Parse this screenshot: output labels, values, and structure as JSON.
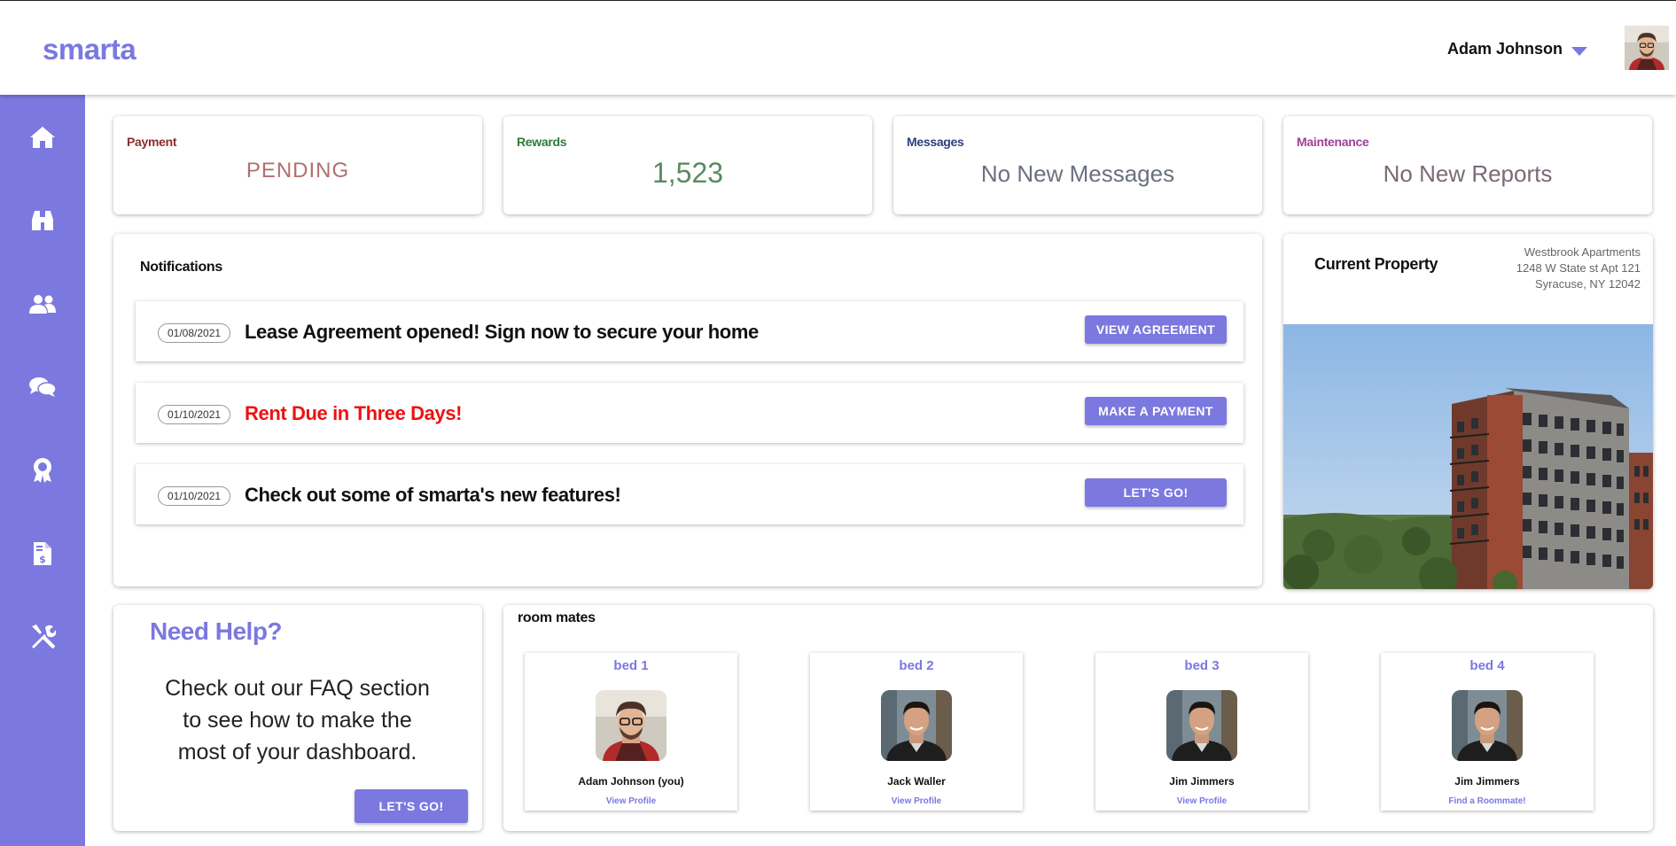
{
  "header": {
    "logo": "smarta",
    "user_name": "Adam Johnson"
  },
  "sidebar": {
    "items": [
      {
        "icon": "home-icon"
      },
      {
        "icon": "binoculars-icon"
      },
      {
        "icon": "users-icon"
      },
      {
        "icon": "chat-icon"
      },
      {
        "icon": "award-icon"
      },
      {
        "icon": "invoice-icon"
      },
      {
        "icon": "tools-icon"
      }
    ]
  },
  "stats": {
    "payment": {
      "label": "Payment",
      "value": "PENDING",
      "label_color": "#8b2e2e",
      "value_color": "#b07070"
    },
    "rewards": {
      "label": "Rewards",
      "value": "1,523",
      "label_color": "#2e7a3e",
      "value_color": "#5b8a60"
    },
    "messages": {
      "label": "Messages",
      "value": "No New Messages",
      "label_color": "#2e3f7a",
      "value_color": "#6a7080"
    },
    "maintenance": {
      "label": "Maintenance",
      "value": "No New Reports",
      "label_color": "#a0409a",
      "value_color": "#7a6a78"
    }
  },
  "notifications": {
    "title": "Notifications",
    "items": [
      {
        "date": "01/08/2021",
        "text": "Lease Agreement opened! Sign now to secure your home",
        "button": "VIEW AGREEMENT",
        "color": "#111111"
      },
      {
        "date": "01/10/2021",
        "text": "Rent Due in Three Days!",
        "button": "MAKE A PAYMENT",
        "color": "#ee1111"
      },
      {
        "date": "01/10/2021",
        "text": "Check out some of smarta's new features!",
        "button": "LET'S GO!",
        "color": "#111111"
      }
    ]
  },
  "property": {
    "title": "Current Property",
    "address_line1": "Westbrook Apartments",
    "address_line2": "1248 W State st Apt 121",
    "address_line3": "Syracuse, NY 12042"
  },
  "help": {
    "title": "Need Help?",
    "line1": "Check out our FAQ section",
    "line2": "to see how to make the",
    "line3": "most of your dashboard.",
    "button": "LET'S GO!"
  },
  "roommates": {
    "title": "room mates",
    "beds": [
      {
        "bed": "bed 1",
        "name": "Adam Johnson (you)",
        "link": "View Profile"
      },
      {
        "bed": "bed 2",
        "name": "Jack Waller",
        "link": "View Profile"
      },
      {
        "bed": "bed 3",
        "name": "Jim Jimmers",
        "link": "View Profile"
      },
      {
        "bed": "bed 4",
        "name": "Jim Jimmers",
        "link": "Find a Roommate!"
      }
    ]
  },
  "colors": {
    "accent": "#7b78e0",
    "alert": "#ee1111"
  }
}
